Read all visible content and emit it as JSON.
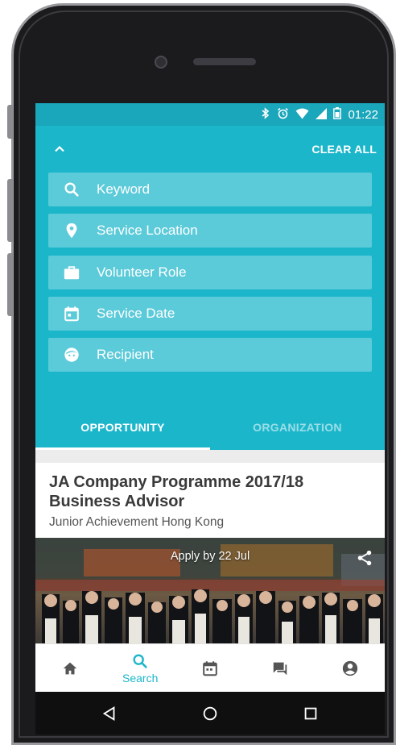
{
  "status_bar": {
    "time": "01:22",
    "icons": [
      "bluetooth-icon",
      "alarm-icon",
      "wifi-icon",
      "signal-icon",
      "battery-icon"
    ]
  },
  "search_panel": {
    "clear_all_label": "CLEAR ALL",
    "fields": [
      {
        "icon": "search-icon",
        "label": "Keyword"
      },
      {
        "icon": "location-pin-icon",
        "label": "Service Location"
      },
      {
        "icon": "briefcase-icon",
        "label": "Volunteer Role"
      },
      {
        "icon": "calendar-icon",
        "label": "Service Date"
      },
      {
        "icon": "face-icon",
        "label": "Recipient"
      }
    ],
    "tabs": [
      {
        "label": "OPPORTUNITY",
        "active": true
      },
      {
        "label": "ORGANIZATION",
        "active": false
      }
    ]
  },
  "card": {
    "title_line1": "JA Company Programme 2017/18",
    "title_line2": "Business Advisor",
    "organization": "Junior Achievement Hong Kong",
    "apply_by": "Apply by 22 Jul"
  },
  "bottom_nav": {
    "items": [
      {
        "icon": "home-icon",
        "label": ""
      },
      {
        "icon": "search-icon",
        "label": "Search",
        "active": true
      },
      {
        "icon": "calendar-icon",
        "label": ""
      },
      {
        "icon": "chat-icon",
        "label": ""
      },
      {
        "icon": "account-icon",
        "label": ""
      }
    ]
  },
  "colors": {
    "primary": "#1cb6cb",
    "status_bar": "#1aa6bb",
    "nav_icon": "#555555"
  }
}
